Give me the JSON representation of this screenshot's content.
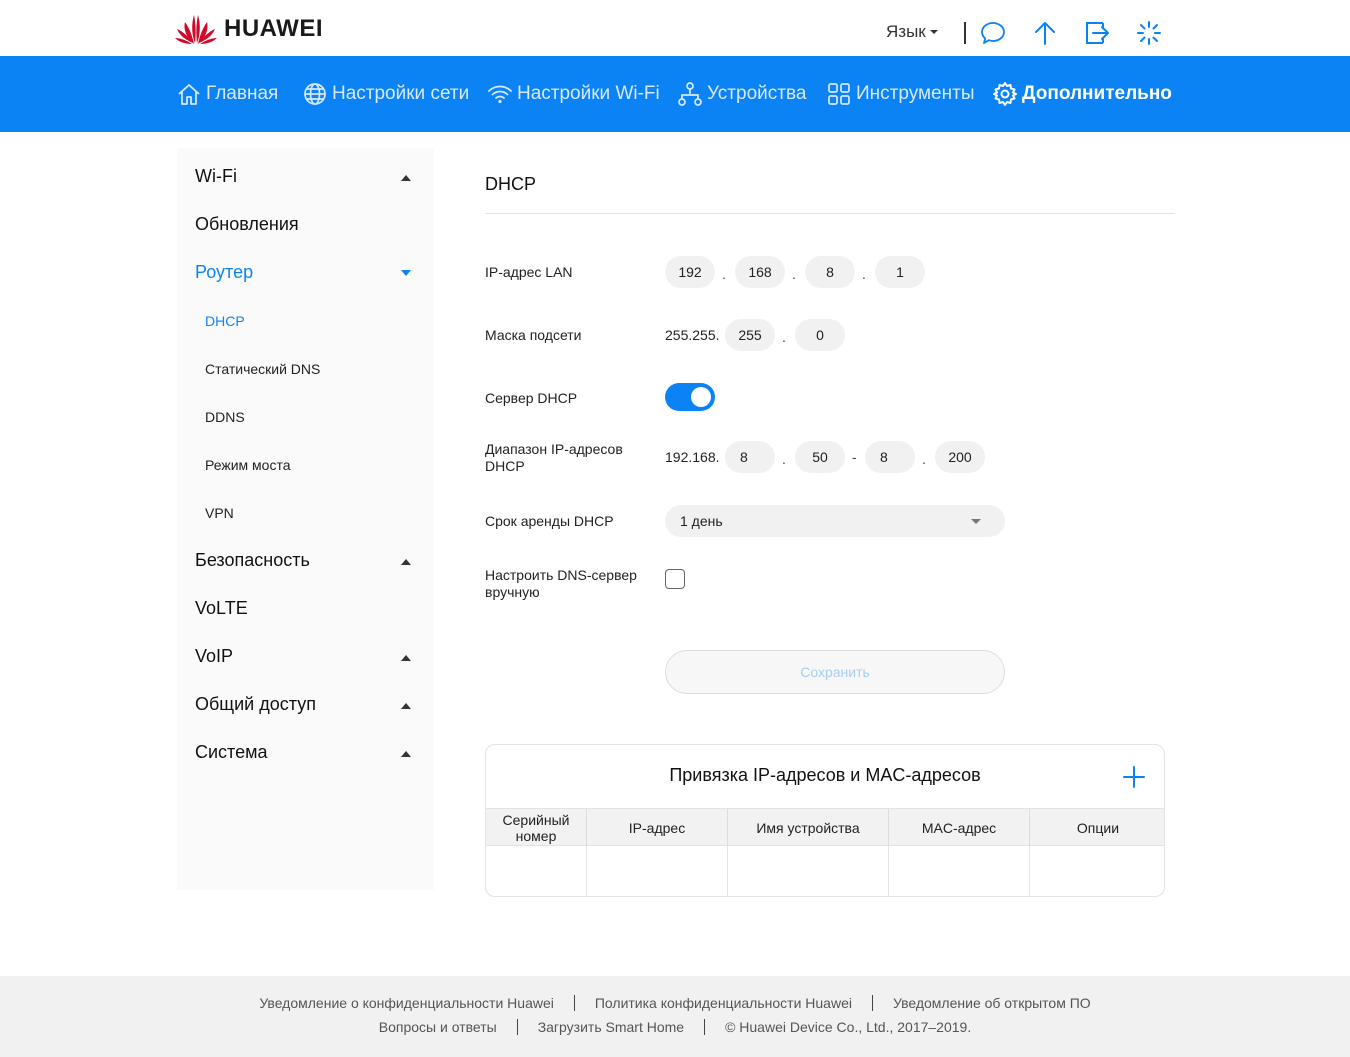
{
  "header": {
    "brand": "HUAWEI",
    "language_label": "Язык",
    "icons": [
      "message-icon",
      "upload-icon",
      "logout-icon",
      "loading-icon"
    ]
  },
  "nav": {
    "items": [
      {
        "label": "Главная",
        "icon": "home-icon"
      },
      {
        "label": "Настройки сети",
        "icon": "globe-icon"
      },
      {
        "label": "Настройки Wi-Fi",
        "icon": "wifi-icon"
      },
      {
        "label": "Устройства",
        "icon": "devices-icon"
      },
      {
        "label": "Инструменты",
        "icon": "tools-icon"
      },
      {
        "label": "Дополнительно",
        "icon": "gear-icon",
        "active": true
      }
    ]
  },
  "sidebar": {
    "items": [
      {
        "label": "Wi-Fi",
        "arrow": "up"
      },
      {
        "label": "Обновления"
      },
      {
        "label": "Роутер",
        "arrow": "down",
        "active": true
      },
      {
        "label": "DHCP",
        "sub": true,
        "active": true
      },
      {
        "label": "Статический DNS",
        "sub": true
      },
      {
        "label": "DDNS",
        "sub": true
      },
      {
        "label": "Режим моста",
        "sub": true
      },
      {
        "label": "VPN",
        "sub": true
      },
      {
        "label": "Безопасность",
        "arrow": "up"
      },
      {
        "label": "VoLTE"
      },
      {
        "label": "VoIP",
        "arrow": "up"
      },
      {
        "label": "Общий доступ",
        "arrow": "up"
      },
      {
        "label": "Система",
        "arrow": "up"
      }
    ]
  },
  "main": {
    "title": "DHCP",
    "lan_ip": {
      "label": "IP-адрес LAN",
      "octets": [
        "192",
        "168",
        "8",
        "1"
      ]
    },
    "subnet_mask": {
      "label": "Маска подсети",
      "prefix": "255.255.",
      "octets": [
        "255",
        "0"
      ]
    },
    "dhcp_server": {
      "label": "Сервер DHCP",
      "enabled": true
    },
    "dhcp_range": {
      "label": "Диапазон IP-адресов DHCP",
      "prefix": "192.168.",
      "start": [
        "8",
        "50"
      ],
      "end": [
        "8",
        "200"
      ],
      "separator": "-"
    },
    "lease_time": {
      "label": "Срок аренды DHCP",
      "value": "1 день"
    },
    "manual_dns": {
      "label": "Настроить DNS-сервер вручную",
      "checked": false
    },
    "save_label": "Сохранить"
  },
  "binding_table": {
    "title": "Привязка IP-адресов и MAC-адресов",
    "columns": [
      "Серийный номер",
      "IP-адрес",
      "Имя устройства",
      "MAC-адрес",
      "Опции"
    ],
    "rows": []
  },
  "footer": {
    "row1": [
      "Уведомление о конфиденциальности Huawei",
      "Политика конфиденциальности Huawei",
      "Уведомление об открытом ПО"
    ],
    "row2": [
      "Вопросы и ответы",
      "Загрузить Smart Home"
    ],
    "copyright": "© Huawei Device Co., Ltd., 2017–2019."
  },
  "colors": {
    "accent": "#0b83f5",
    "brand_red": "#cf0a2c",
    "footer_bg": "#f1f1f1"
  }
}
